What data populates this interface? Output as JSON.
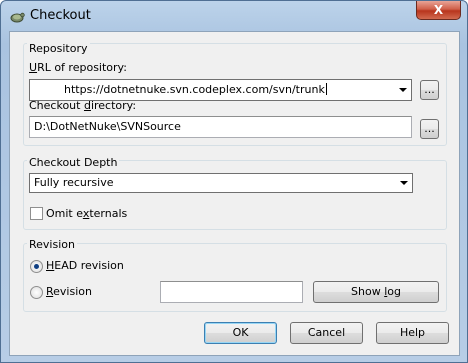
{
  "window": {
    "title": "Checkout",
    "close_symbol": "X"
  },
  "repository": {
    "group_label": "Repository",
    "url_label_u": "U",
    "url_label_rest": "RL of repository:",
    "url_value": "https://dotnetnuke.svn.codeplex.com/svn/trunk",
    "browse_url_label": "...",
    "dir_label_pre": "Checkout ",
    "dir_label_u": "d",
    "dir_label_rest": "irectory:",
    "dir_value": "D:\\DotNetNuke\\SVNSource",
    "browse_dir_label": "..."
  },
  "depth": {
    "group_label": "Checkout Depth",
    "selected": "Fully recursive",
    "omit_externals_pre": "Omit e",
    "omit_externals_u": "x",
    "omit_externals_rest": "ternals",
    "omit_externals_checked": false
  },
  "revision": {
    "group_label": "Revision",
    "head_u": "H",
    "head_rest": "EAD revision",
    "head_selected": true,
    "rev_u": "R",
    "rev_rest": "evision",
    "rev_value": "",
    "show_log_pre": "Show ",
    "show_log_u": "l",
    "show_log_rest": "og"
  },
  "buttons": {
    "ok": "OK",
    "cancel": "Cancel",
    "help": "Help"
  }
}
